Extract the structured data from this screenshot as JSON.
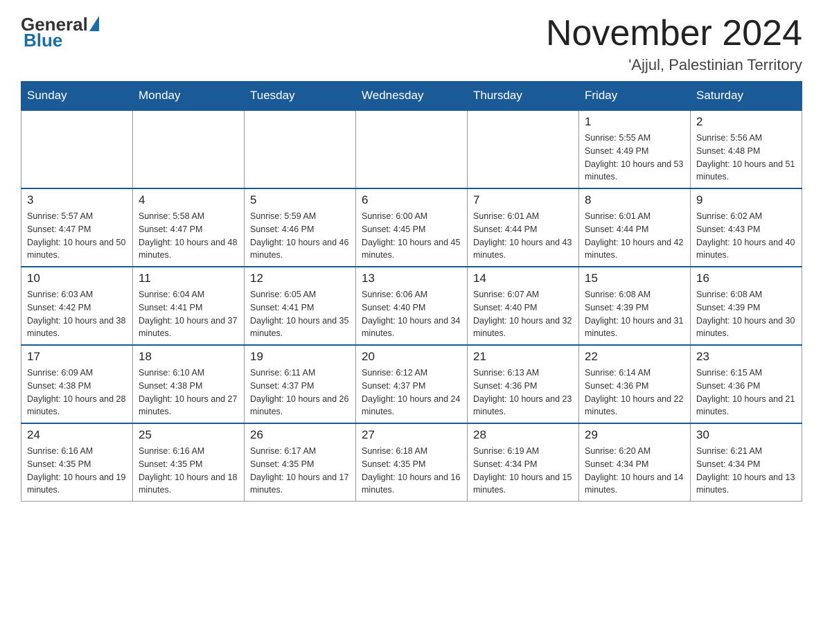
{
  "header": {
    "logo": {
      "general": "General",
      "blue": "Blue"
    },
    "title": "November 2024",
    "subtitle": "'Ajjul, Palestinian Territory"
  },
  "days_of_week": [
    "Sunday",
    "Monday",
    "Tuesday",
    "Wednesday",
    "Thursday",
    "Friday",
    "Saturday"
  ],
  "weeks": [
    [
      {
        "day": "",
        "sunrise": "",
        "sunset": "",
        "daylight": ""
      },
      {
        "day": "",
        "sunrise": "",
        "sunset": "",
        "daylight": ""
      },
      {
        "day": "",
        "sunrise": "",
        "sunset": "",
        "daylight": ""
      },
      {
        "day": "",
        "sunrise": "",
        "sunset": "",
        "daylight": ""
      },
      {
        "day": "",
        "sunrise": "",
        "sunset": "",
        "daylight": ""
      },
      {
        "day": "1",
        "sunrise": "Sunrise: 5:55 AM",
        "sunset": "Sunset: 4:49 PM",
        "daylight": "Daylight: 10 hours and 53 minutes."
      },
      {
        "day": "2",
        "sunrise": "Sunrise: 5:56 AM",
        "sunset": "Sunset: 4:48 PM",
        "daylight": "Daylight: 10 hours and 51 minutes."
      }
    ],
    [
      {
        "day": "3",
        "sunrise": "Sunrise: 5:57 AM",
        "sunset": "Sunset: 4:47 PM",
        "daylight": "Daylight: 10 hours and 50 minutes."
      },
      {
        "day": "4",
        "sunrise": "Sunrise: 5:58 AM",
        "sunset": "Sunset: 4:47 PM",
        "daylight": "Daylight: 10 hours and 48 minutes."
      },
      {
        "day": "5",
        "sunrise": "Sunrise: 5:59 AM",
        "sunset": "Sunset: 4:46 PM",
        "daylight": "Daylight: 10 hours and 46 minutes."
      },
      {
        "day": "6",
        "sunrise": "Sunrise: 6:00 AM",
        "sunset": "Sunset: 4:45 PM",
        "daylight": "Daylight: 10 hours and 45 minutes."
      },
      {
        "day": "7",
        "sunrise": "Sunrise: 6:01 AM",
        "sunset": "Sunset: 4:44 PM",
        "daylight": "Daylight: 10 hours and 43 minutes."
      },
      {
        "day": "8",
        "sunrise": "Sunrise: 6:01 AM",
        "sunset": "Sunset: 4:44 PM",
        "daylight": "Daylight: 10 hours and 42 minutes."
      },
      {
        "day": "9",
        "sunrise": "Sunrise: 6:02 AM",
        "sunset": "Sunset: 4:43 PM",
        "daylight": "Daylight: 10 hours and 40 minutes."
      }
    ],
    [
      {
        "day": "10",
        "sunrise": "Sunrise: 6:03 AM",
        "sunset": "Sunset: 4:42 PM",
        "daylight": "Daylight: 10 hours and 38 minutes."
      },
      {
        "day": "11",
        "sunrise": "Sunrise: 6:04 AM",
        "sunset": "Sunset: 4:41 PM",
        "daylight": "Daylight: 10 hours and 37 minutes."
      },
      {
        "day": "12",
        "sunrise": "Sunrise: 6:05 AM",
        "sunset": "Sunset: 4:41 PM",
        "daylight": "Daylight: 10 hours and 35 minutes."
      },
      {
        "day": "13",
        "sunrise": "Sunrise: 6:06 AM",
        "sunset": "Sunset: 4:40 PM",
        "daylight": "Daylight: 10 hours and 34 minutes."
      },
      {
        "day": "14",
        "sunrise": "Sunrise: 6:07 AM",
        "sunset": "Sunset: 4:40 PM",
        "daylight": "Daylight: 10 hours and 32 minutes."
      },
      {
        "day": "15",
        "sunrise": "Sunrise: 6:08 AM",
        "sunset": "Sunset: 4:39 PM",
        "daylight": "Daylight: 10 hours and 31 minutes."
      },
      {
        "day": "16",
        "sunrise": "Sunrise: 6:08 AM",
        "sunset": "Sunset: 4:39 PM",
        "daylight": "Daylight: 10 hours and 30 minutes."
      }
    ],
    [
      {
        "day": "17",
        "sunrise": "Sunrise: 6:09 AM",
        "sunset": "Sunset: 4:38 PM",
        "daylight": "Daylight: 10 hours and 28 minutes."
      },
      {
        "day": "18",
        "sunrise": "Sunrise: 6:10 AM",
        "sunset": "Sunset: 4:38 PM",
        "daylight": "Daylight: 10 hours and 27 minutes."
      },
      {
        "day": "19",
        "sunrise": "Sunrise: 6:11 AM",
        "sunset": "Sunset: 4:37 PM",
        "daylight": "Daylight: 10 hours and 26 minutes."
      },
      {
        "day": "20",
        "sunrise": "Sunrise: 6:12 AM",
        "sunset": "Sunset: 4:37 PM",
        "daylight": "Daylight: 10 hours and 24 minutes."
      },
      {
        "day": "21",
        "sunrise": "Sunrise: 6:13 AM",
        "sunset": "Sunset: 4:36 PM",
        "daylight": "Daylight: 10 hours and 23 minutes."
      },
      {
        "day": "22",
        "sunrise": "Sunrise: 6:14 AM",
        "sunset": "Sunset: 4:36 PM",
        "daylight": "Daylight: 10 hours and 22 minutes."
      },
      {
        "day": "23",
        "sunrise": "Sunrise: 6:15 AM",
        "sunset": "Sunset: 4:36 PM",
        "daylight": "Daylight: 10 hours and 21 minutes."
      }
    ],
    [
      {
        "day": "24",
        "sunrise": "Sunrise: 6:16 AM",
        "sunset": "Sunset: 4:35 PM",
        "daylight": "Daylight: 10 hours and 19 minutes."
      },
      {
        "day": "25",
        "sunrise": "Sunrise: 6:16 AM",
        "sunset": "Sunset: 4:35 PM",
        "daylight": "Daylight: 10 hours and 18 minutes."
      },
      {
        "day": "26",
        "sunrise": "Sunrise: 6:17 AM",
        "sunset": "Sunset: 4:35 PM",
        "daylight": "Daylight: 10 hours and 17 minutes."
      },
      {
        "day": "27",
        "sunrise": "Sunrise: 6:18 AM",
        "sunset": "Sunset: 4:35 PM",
        "daylight": "Daylight: 10 hours and 16 minutes."
      },
      {
        "day": "28",
        "sunrise": "Sunrise: 6:19 AM",
        "sunset": "Sunset: 4:34 PM",
        "daylight": "Daylight: 10 hours and 15 minutes."
      },
      {
        "day": "29",
        "sunrise": "Sunrise: 6:20 AM",
        "sunset": "Sunset: 4:34 PM",
        "daylight": "Daylight: 10 hours and 14 minutes."
      },
      {
        "day": "30",
        "sunrise": "Sunrise: 6:21 AM",
        "sunset": "Sunset: 4:34 PM",
        "daylight": "Daylight: 10 hours and 13 minutes."
      }
    ]
  ]
}
